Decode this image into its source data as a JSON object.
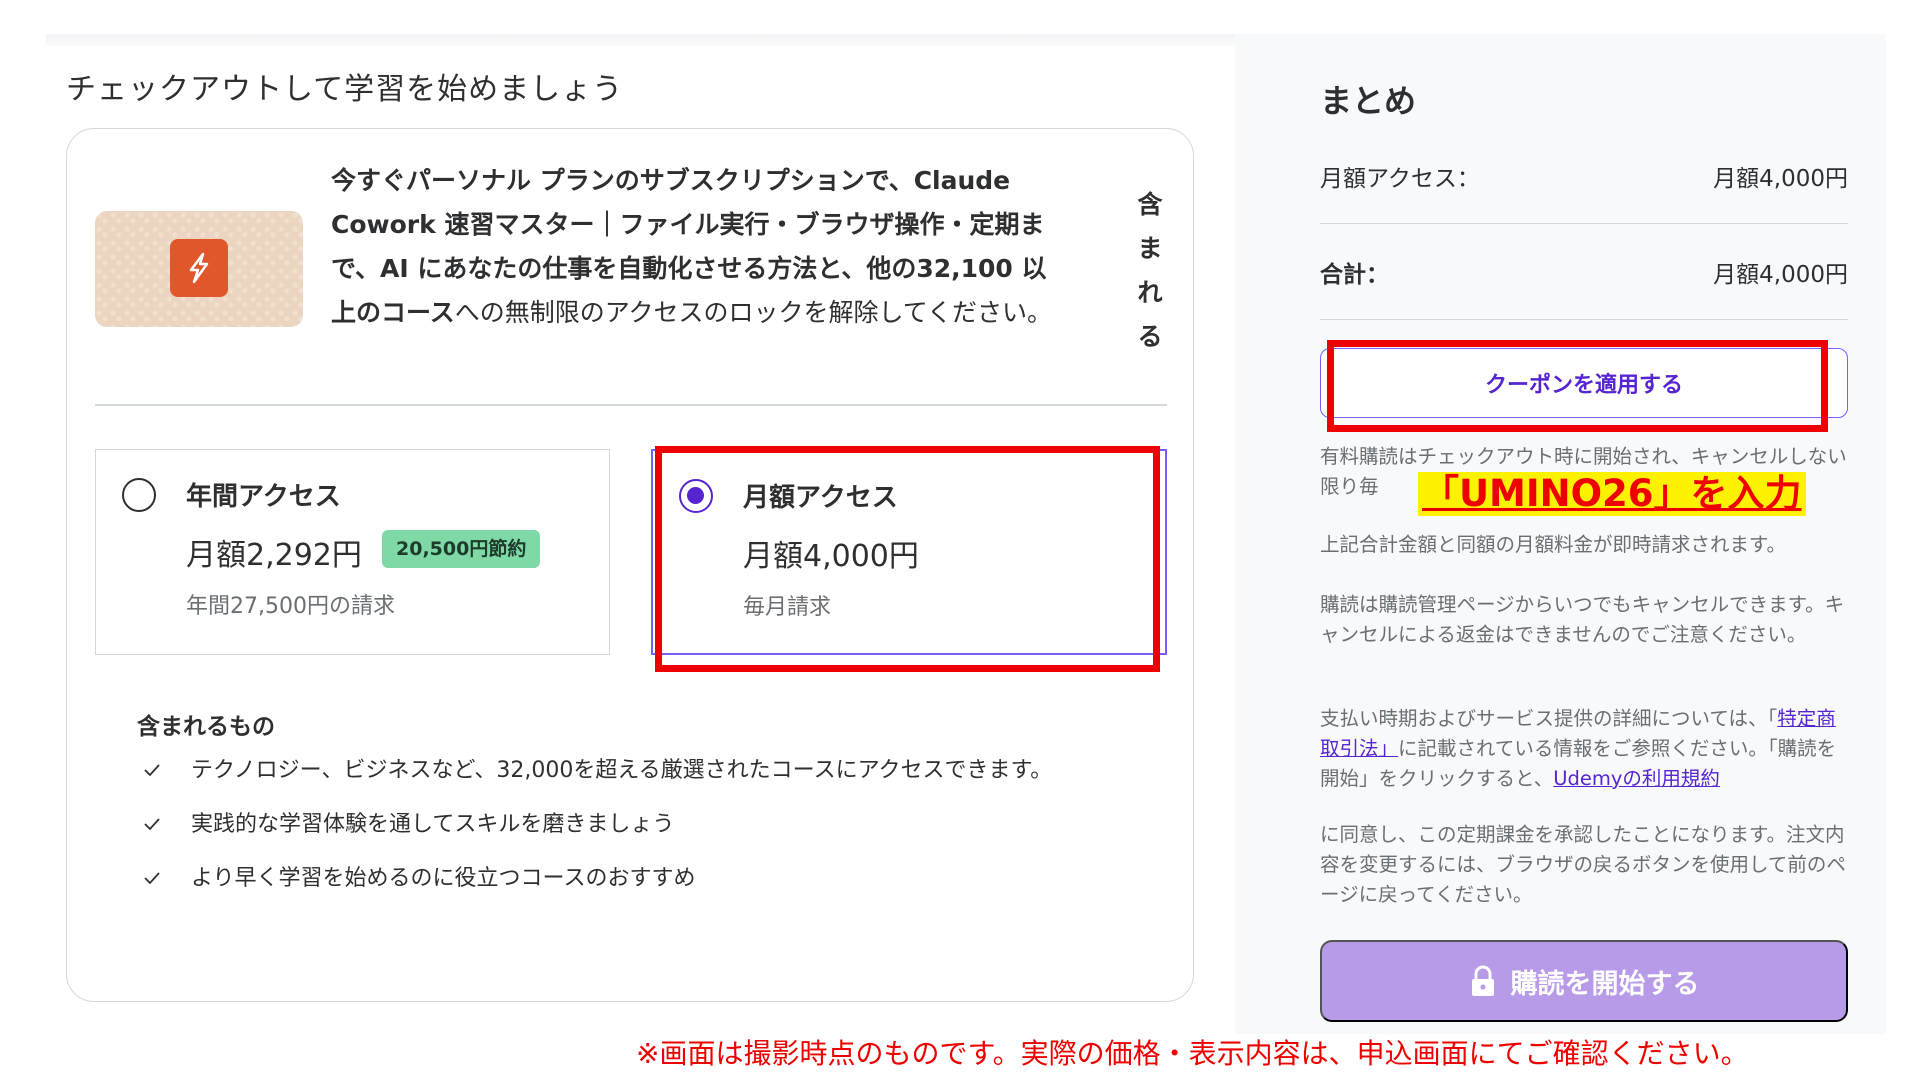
{
  "page": {
    "title": "チェックアウトして学習を始めましょう"
  },
  "course": {
    "promo_bold_1": "今すぐパーソナル プランのサブスクリプションで、Claude Cowork 速習マスター｜ファイル実行・ブラウザ操作・定期まで、AI にあなたの仕事を自動化させる方法と、他の",
    "promo_bold_2": "32,100 以上のコース",
    "promo_rest": "への無制限のアクセスのロックを解除してください。",
    "side_label": "含まれる"
  },
  "plans": {
    "annual": {
      "name": "年間アクセス",
      "price": "月額2,292円",
      "badge": "20,500円節約",
      "sub": "年間27,500円の請求"
    },
    "monthly": {
      "name": "月額アクセス",
      "price": "月額4,000円",
      "sub": "毎月請求"
    }
  },
  "includes": {
    "title": "含まれるもの",
    "items": [
      "テクノロジー、ビジネスなど、32,000を超える厳選されたコースにアクセスできます。",
      "実践的な学習体験を通してスキルを磨きましょう",
      "より早く学習を始めるのに役立つコースのおすすめ"
    ]
  },
  "summary": {
    "title": "まとめ",
    "row1_label": "月額アクセス：",
    "row1_value": "月額4,000円",
    "row2_label": "合計：",
    "row2_value": "月額4,000円",
    "coupon_label": "クーポンを適用する",
    "fine1": "有料購読はチェックアウト時に開始され、キャンセルしない限り毎",
    "fine2": "上記合計金額と同額の月額料金が即時請求されます。",
    "fine3": "購読は購読管理ページからいつでもキャンセルできます。キャンセルによる返金はできませんのでご注意ください。",
    "fine4_a": "支払い時期およびサービス提供の詳細については、「",
    "fine4_link": "特定商取引法」",
    "fine4_b": "に記載されている情報をご参照ください。「購読を開始」をクリックすると、",
    "fine4_link2": "Udemyの利用規約",
    "fine5": "に同意し、この定期課金を承認したことになります。注文内容を変更するには、ブラウザの戻るボタンを使用して前のページに戻ってください。",
    "subscribe_label": "購読を開始する"
  },
  "annotations": {
    "coupon_code_hint": "「UMINO26」を入力",
    "disclaimer": "※画面は撮影時点のものです。実際の価格・表示内容は、申込画面にてご確認ください。"
  },
  "colors": {
    "accent": "#5624d0",
    "annotation_red": "#ee0000",
    "highlight_yellow": "#fff200",
    "subscribe_bg": "#b79ae8",
    "badge_bg": "#7ed9a6"
  }
}
